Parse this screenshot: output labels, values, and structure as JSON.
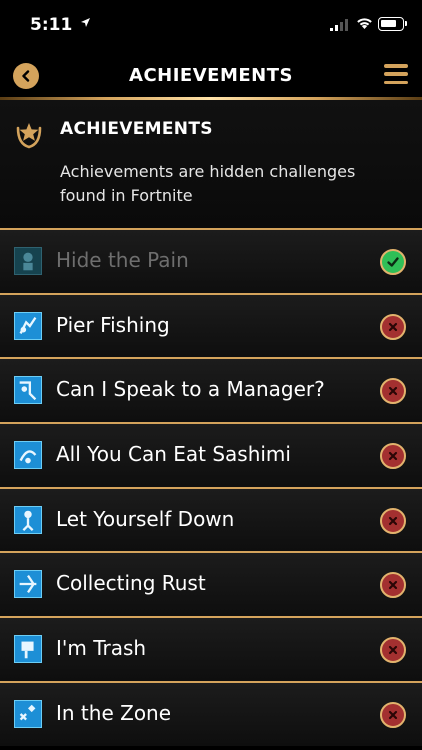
{
  "status_bar": {
    "time": "5:11"
  },
  "nav": {
    "title": "ACHIEVEMENTS"
  },
  "header": {
    "title": "ACHIEVEMENTS",
    "description": "Achievements are hidden challenges found in Fortnite"
  },
  "achievements": [
    {
      "label": "Hide the Pain",
      "completed": true
    },
    {
      "label": "Pier Fishing",
      "completed": false
    },
    {
      "label": "Can I Speak to a Manager?",
      "completed": false
    },
    {
      "label": "All You Can Eat Sashimi",
      "completed": false
    },
    {
      "label": "Let Yourself Down",
      "completed": false
    },
    {
      "label": "Collecting Rust",
      "completed": false
    },
    {
      "label": "I'm Trash",
      "completed": false
    },
    {
      "label": "In the Zone",
      "completed": false
    }
  ],
  "colors": {
    "accent_gold": "#d4a35c",
    "completed_green": "#2fbf57",
    "incomplete_red": "#a33030",
    "icon_blue": "#1d8fd6"
  }
}
